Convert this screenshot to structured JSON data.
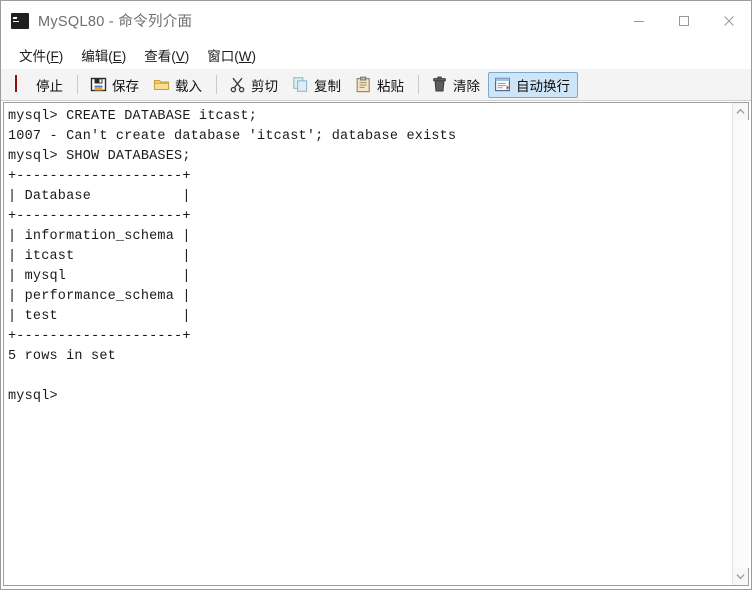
{
  "window": {
    "title": "MySQL80 - 命令列介面",
    "icon": "console-icon",
    "controls": {
      "minimize": "minimize-button",
      "maximize": "maximize-button",
      "close": "close-button"
    }
  },
  "menubar": [
    {
      "label": "文件",
      "accel": "F"
    },
    {
      "label": "编辑",
      "accel": "E"
    },
    {
      "label": "查看",
      "accel": "V"
    },
    {
      "label": "窗口",
      "accel": "W"
    }
  ],
  "toolbar": {
    "items": [
      {
        "label": "停止",
        "icon": "stop-icon",
        "active": false
      },
      {
        "label": "保存",
        "icon": "save-icon",
        "active": false
      },
      {
        "label": "载入",
        "icon": "folder-open-icon",
        "active": false
      },
      {
        "label": "剪切",
        "icon": "scissors-icon",
        "active": false
      },
      {
        "label": "复制",
        "icon": "copy-icon",
        "active": false
      },
      {
        "label": "粘贴",
        "icon": "paste-icon",
        "active": false
      },
      {
        "label": "清除",
        "icon": "trash-icon",
        "active": false
      },
      {
        "label": "自动换行",
        "icon": "word-wrap-icon",
        "active": true
      }
    ]
  },
  "console": {
    "prompt": "mysql>",
    "text": "mysql> CREATE DATABASE itcast;\n1007 - Can't create database 'itcast'; database exists\nmysql> SHOW DATABASES;\n+--------------------+\n| Database           |\n+--------------------+\n| information_schema |\n| itcast             |\n| mysql              |\n| performance_schema |\n| test               |\n+--------------------+\n5 rows in set\n\nmysql>",
    "lines": [
      "mysql> CREATE DATABASE itcast;",
      "1007 - Can't create database 'itcast'; database exists",
      "mysql> SHOW DATABASES;",
      "+--------------------+",
      "| Database           |",
      "+--------------------+",
      "| information_schema |",
      "| itcast             |",
      "| mysql              |",
      "| performance_schema |",
      "| test               |",
      "+--------------------+",
      "5 rows in set",
      "",
      "mysql>"
    ],
    "databases": [
      "information_schema",
      "itcast",
      "mysql",
      "performance_schema",
      "test"
    ],
    "row_count_text": "5 rows in set",
    "error_code": "1007",
    "error_message": "Can't create database 'itcast'; database exists"
  },
  "colors": {
    "accent": "#cde5f7",
    "accent_border": "#7aa9cd",
    "stop_red": "#dd1f1f",
    "folder_yellow": "#f2cf6a",
    "toolbar_bg": "#f4f4f4",
    "title_text": "#6e6e6e",
    "console_text": "#1a1a1a"
  }
}
